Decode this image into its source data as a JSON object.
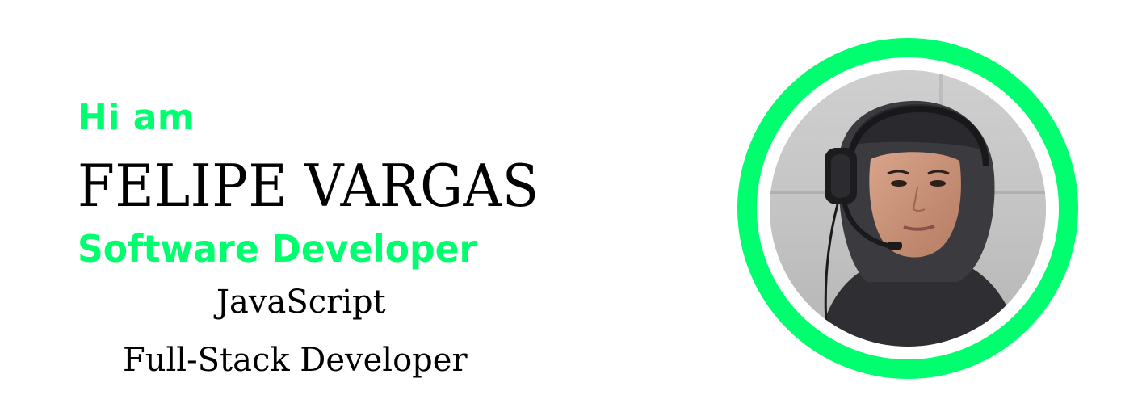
{
  "hero": {
    "greeting": "Hi am",
    "name": "FELIPE VARGAS",
    "role": "Software Developer",
    "skills": [
      "JavaScript",
      "Full-Stack Developer"
    ]
  },
  "avatar": {
    "icon": "profile-photo",
    "ring_color": "#00ff6e"
  },
  "colors": {
    "accent": "#00ff6e",
    "text": "#000000",
    "background": "#ffffff"
  }
}
